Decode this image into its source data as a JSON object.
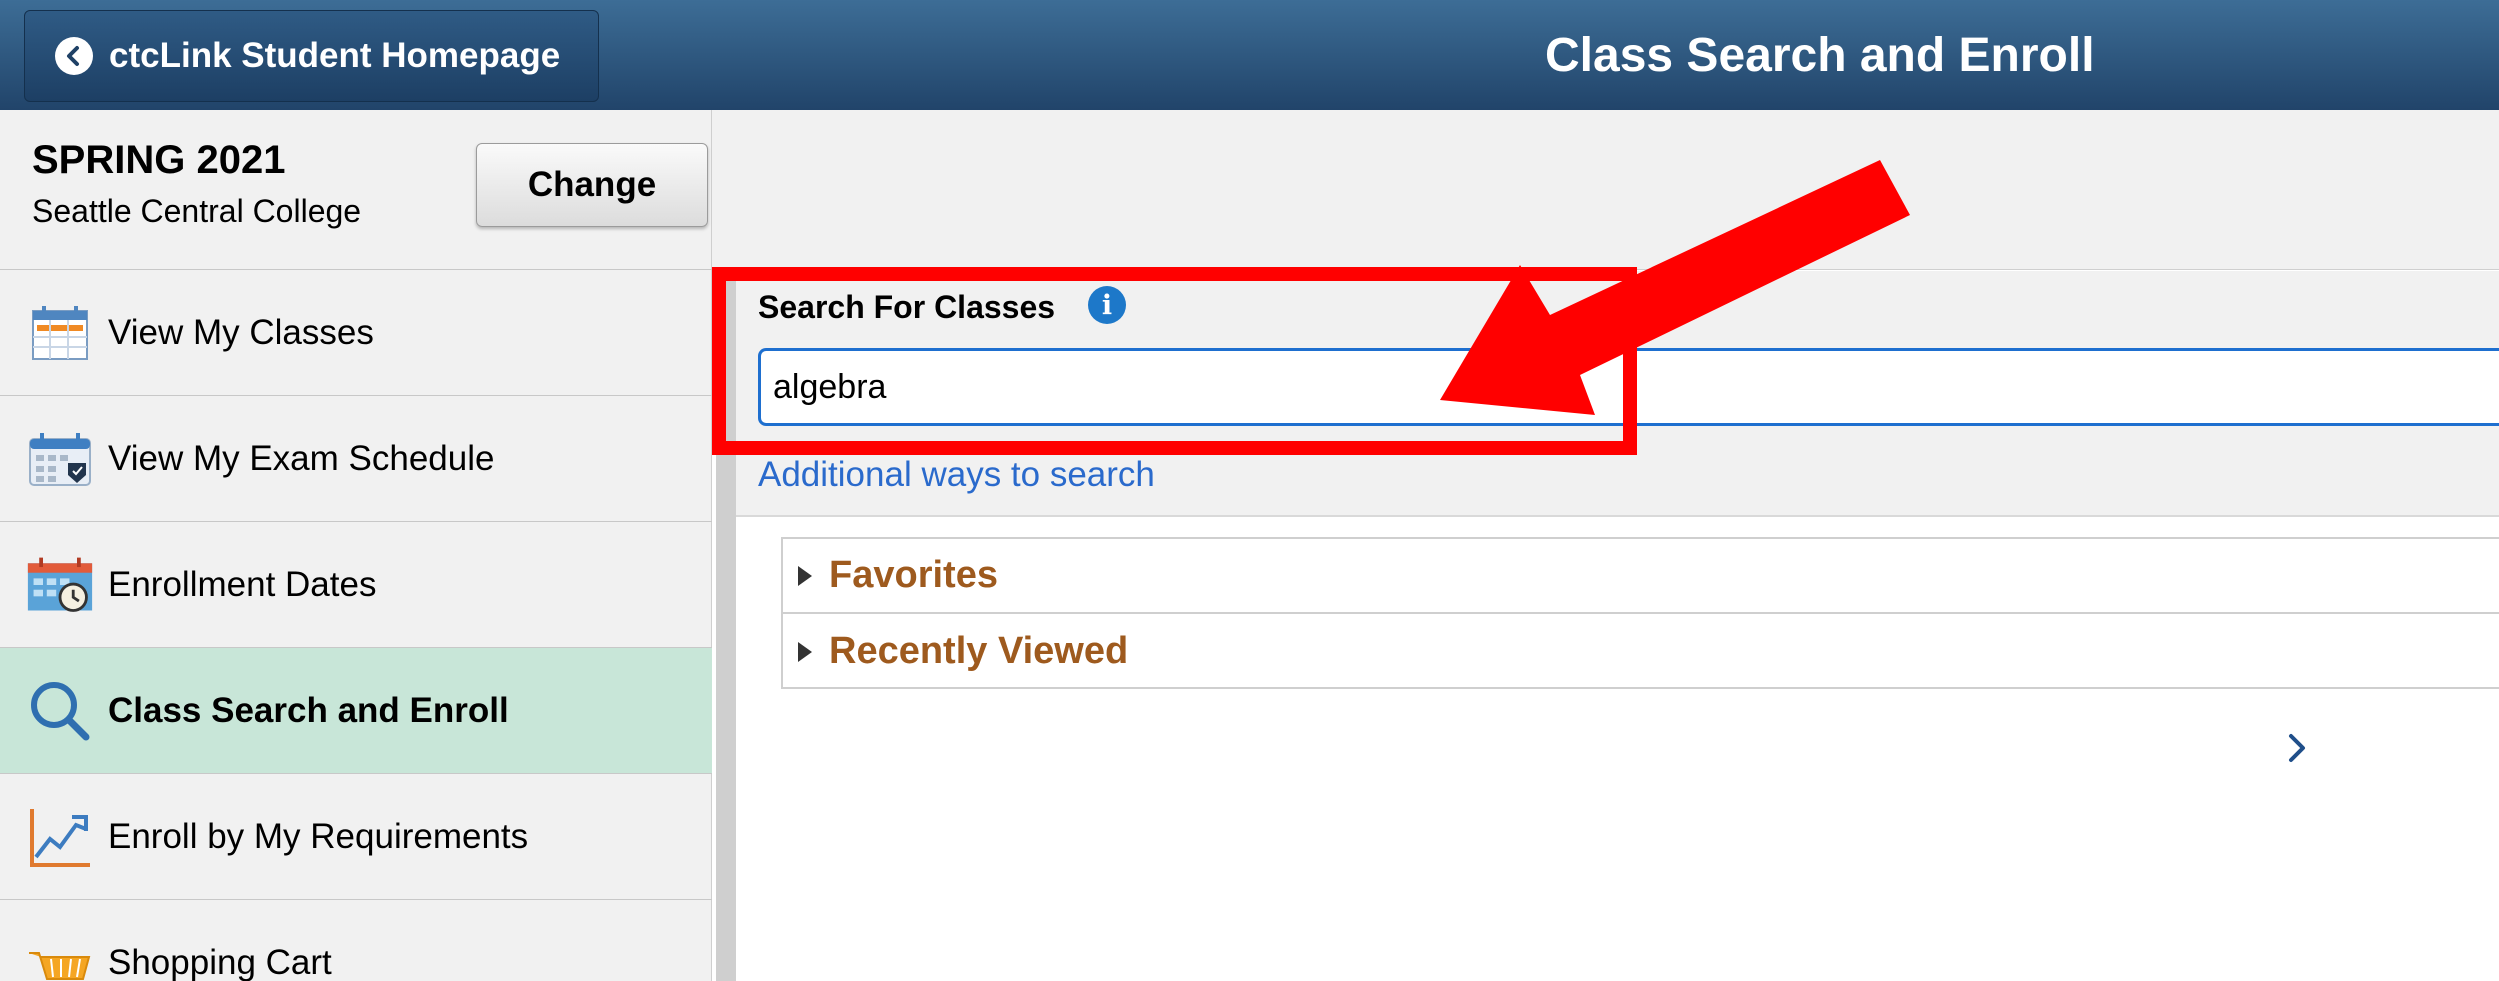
{
  "header": {
    "back_label": "ctcLink Student Homepage",
    "title": "Class Search and Enroll"
  },
  "term": {
    "name": "SPRING 2021",
    "school": "Seattle Central College",
    "change_label": "Change"
  },
  "sidebar": {
    "items": [
      {
        "label": "View My Classes",
        "icon": "calendar-icon"
      },
      {
        "label": "View My Exam Schedule",
        "icon": "exam-schedule-icon"
      },
      {
        "label": "Enrollment Dates",
        "icon": "calendar-clock-icon"
      },
      {
        "label": "Class Search and Enroll",
        "icon": "search-icon",
        "active": true
      },
      {
        "label": "Enroll by My Requirements",
        "icon": "chart-icon"
      },
      {
        "label": "Shopping Cart",
        "icon": "cart-icon"
      }
    ]
  },
  "search": {
    "label": "Search For Classes",
    "value": "algebra",
    "additional_link": "Additional ways to search"
  },
  "sections": [
    {
      "label": "Favorites"
    },
    {
      "label": "Recently Viewed"
    }
  ],
  "colors": {
    "header": "#2b537b",
    "active_item": "#c8e6d8",
    "section_text": "#9e5a1e",
    "link": "#2a6acc",
    "annotation": "#ff0000"
  }
}
